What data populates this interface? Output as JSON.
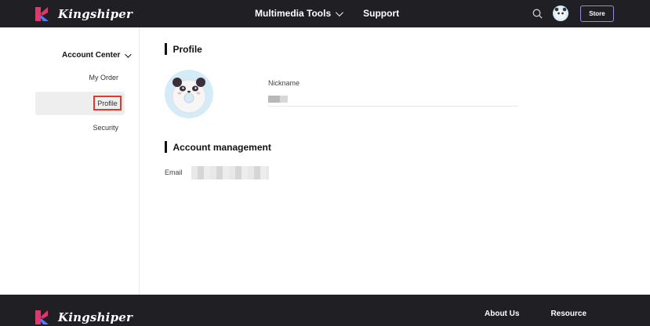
{
  "header": {
    "brand_name": "Kingshiper",
    "nav": [
      {
        "label": "Multimedia Tools",
        "has_dropdown": true
      },
      {
        "label": "Support",
        "has_dropdown": false
      }
    ],
    "store_label": "Store",
    "icons": [
      "search-icon",
      "user-avatar"
    ]
  },
  "sidebar": {
    "section_label": "Account Center",
    "items": [
      {
        "label": "My Order"
      },
      {
        "label": "Profile",
        "selected": true
      },
      {
        "label": "Security"
      }
    ]
  },
  "profile": {
    "title": "Profile",
    "nickname_label": "Nickname",
    "nickname_value": ""
  },
  "account": {
    "title": "Account management",
    "email_label": "Email",
    "email_value": ""
  },
  "footer": {
    "brand_name": "Kingshiper",
    "links": [
      "About Us",
      "Resource"
    ]
  },
  "colors": {
    "header_bg": "#1f1f24",
    "logo_primary": "#e8336b",
    "logo_secondary": "#4d7cfe",
    "selection_highlight": "#e03a2f",
    "store_border": "#9a8bd8"
  }
}
